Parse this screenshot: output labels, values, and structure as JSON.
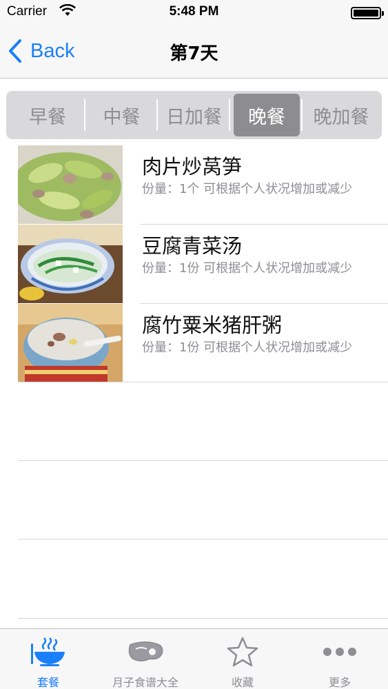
{
  "status_bar": {
    "carrier": "Carrier",
    "time": "5:48 PM",
    "battery_level": 1.0
  },
  "nav": {
    "back_label": "Back",
    "title": "第7天"
  },
  "segments": {
    "items": [
      "早餐",
      "中餐",
      "日加餐",
      "晚餐",
      "晚加餐"
    ],
    "selected": "晚餐"
  },
  "meals": [
    {
      "name": "肉片炒莴笋",
      "portion": "份量：1个 可根据个人状况增加或减少",
      "image": "stir-fried-lettuce-photo"
    },
    {
      "name": "豆腐青菜汤",
      "portion": "份量：1份 可根据个人状况增加或减少",
      "image": "tofu-greens-soup-photo"
    },
    {
      "name": "腐竹粟米猪肝粥",
      "portion": "份量：1份 可根据个人状况增加或减少",
      "image": "pork-liver-congee-photo"
    }
  ],
  "tabs": [
    {
      "label": "套餐",
      "icon": "meal-bowl-icon",
      "active": true
    },
    {
      "label": "月子食谱大全",
      "icon": "meat-icon",
      "active": false
    },
    {
      "label": "收藏",
      "icon": "star-icon",
      "active": false
    },
    {
      "label": "更多",
      "icon": "more-dots-icon",
      "active": false
    }
  ],
  "colors": {
    "accent": "#1a7ffb",
    "segment_selected": "#8d8d8f",
    "inactive": "#8e8e93"
  }
}
